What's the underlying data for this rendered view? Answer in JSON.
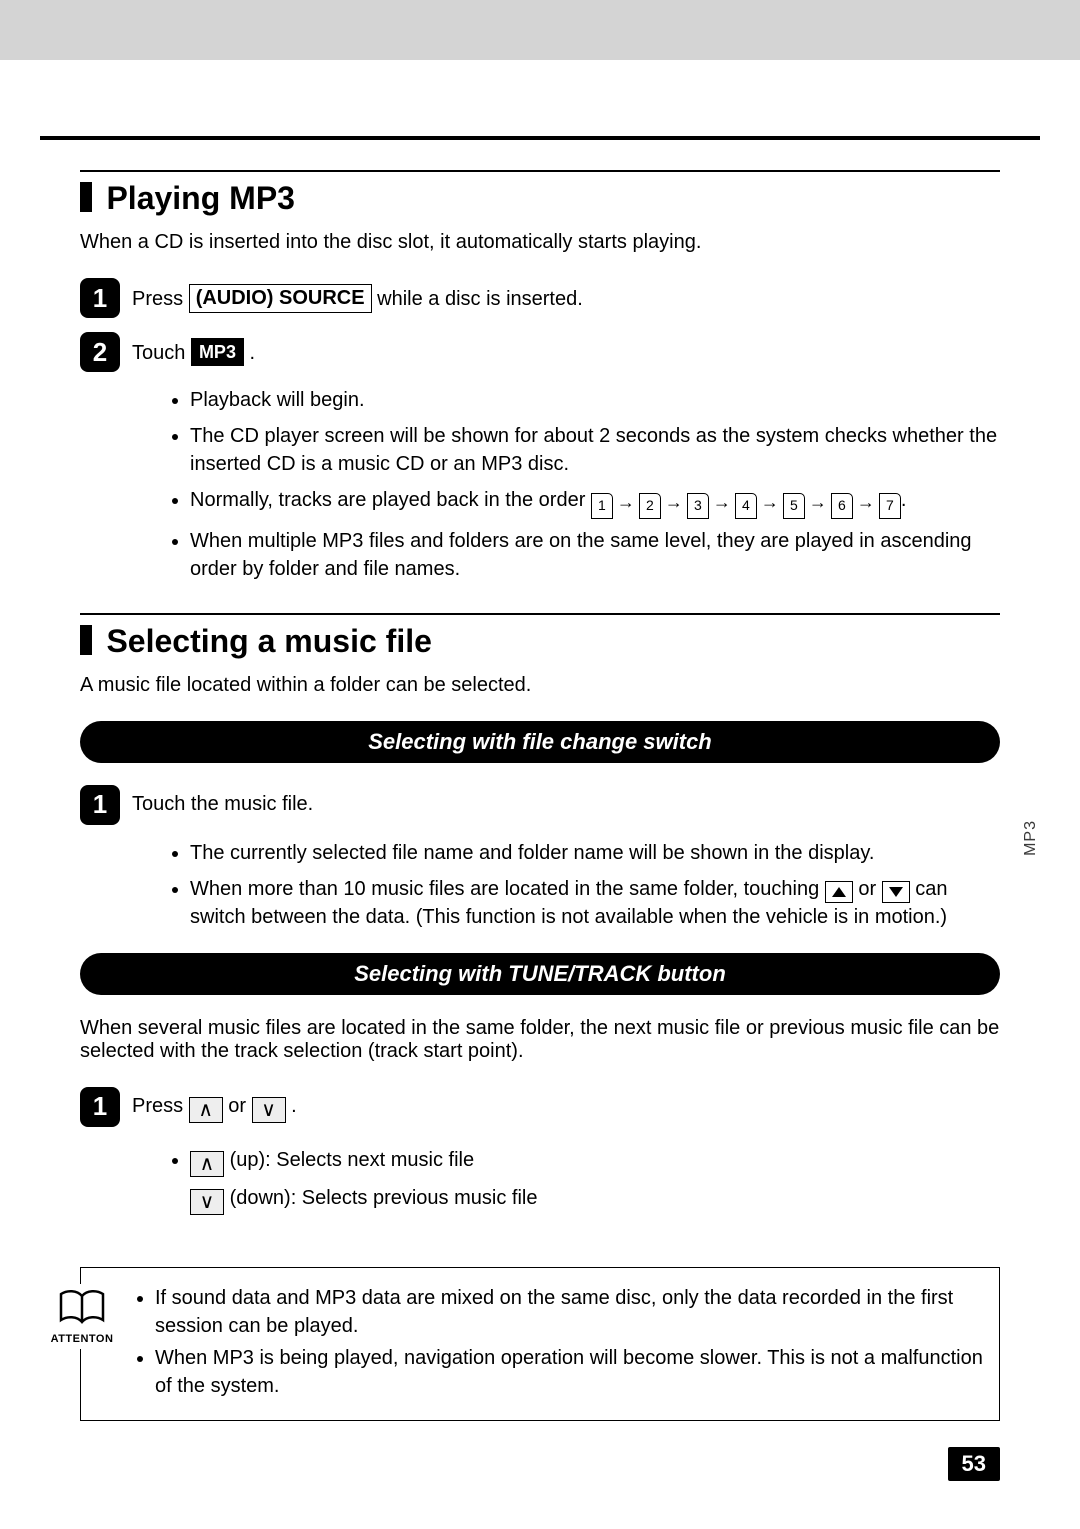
{
  "side_tab": "MP3",
  "page_number": "53",
  "section1": {
    "title": "Playing MP3",
    "intro": "When a CD is inserted into the disc slot, it automatically starts playing.",
    "step1_prefix": "Press ",
    "step1_button": "(AUDIO) SOURCE",
    "step1_suffix": " while a disc is inserted.",
    "step2_prefix": "Touch ",
    "step2_button": "MP3",
    "step2_suffix": " .",
    "bullets": [
      "Playback will begin.",
      "The CD player screen will be shown for about 2 seconds as the system checks whether the inserted CD is a music CD or an MP3 disc."
    ],
    "bullet_order_prefix": "Normally, tracks are played back in the order ",
    "track_numbers": [
      "1",
      "2",
      "3",
      "4",
      "5",
      "6",
      "7"
    ],
    "bullet_multi": "When multiple MP3 files and folders are on the same level, they are played in ascending order by folder and file names."
  },
  "section2": {
    "title": "Selecting a music file",
    "intro": "A music file located within a folder can be selected.",
    "pill1": "Selecting with file change switch",
    "step1": "Touch the music file.",
    "bullets1": [
      "The currently selected file name and folder name will be shown in the display."
    ],
    "bullet_switch_a": "When more than 10 music files are located in the same folder, touching ",
    "bullet_switch_b": " or ",
    "bullet_switch_c": " can switch between the data.  (This function is not available when the vehicle is in motion.)",
    "pill2": "Selecting with TUNE/TRACK button",
    "intro2": "When several music files are located in the same folder, the next music file or previous music file can be selected with the track selection (track start point).",
    "step_press_prefix": "Press ",
    "step_press_mid": " or ",
    "step_press_suffix": " .",
    "up_text": " (up): Selects next music file",
    "down_text": " (down): Selects previous music file"
  },
  "attention": {
    "label": "ATTENTON",
    "items": [
      "If sound data and MP3 data are mixed on the same disc, only the data recorded in the first session can be played.",
      "When MP3 is being played, navigation operation will become slower.  This is not a malfunction of the system."
    ]
  }
}
